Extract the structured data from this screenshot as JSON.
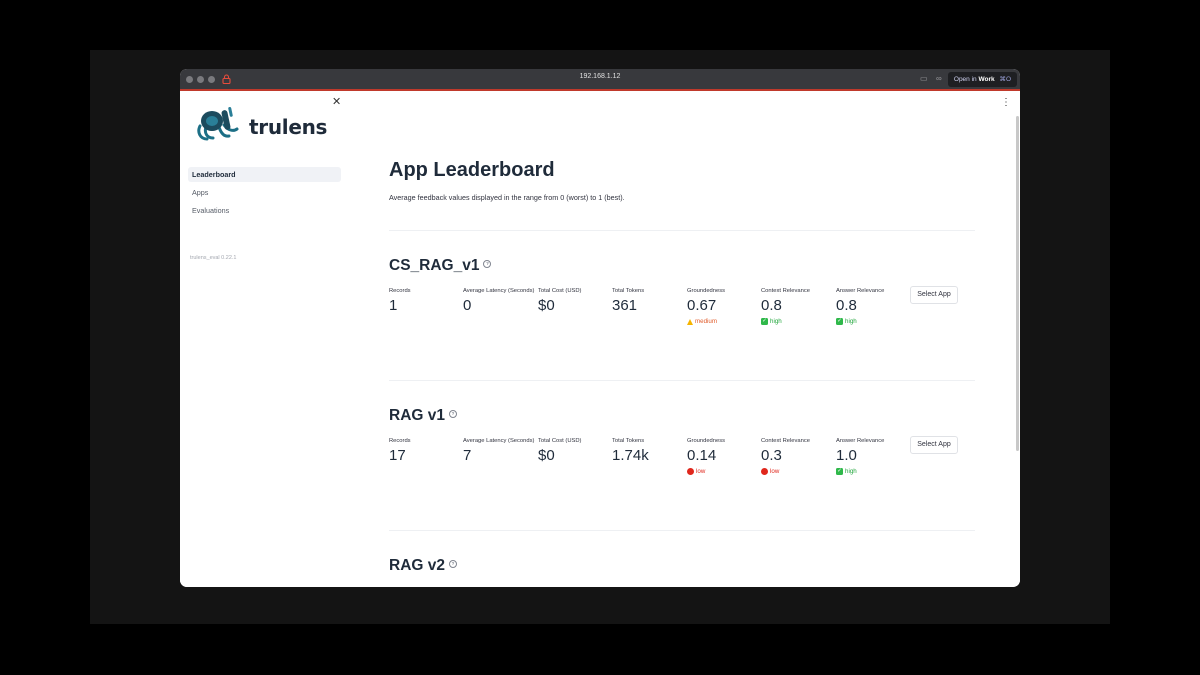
{
  "browser": {
    "url": "192.168.1.12",
    "open_in_prefix": "Open in",
    "open_in_target": "Work",
    "open_in_shortcut": "⌘O"
  },
  "sidebar": {
    "brand": "trulens",
    "nav": [
      {
        "label": "Leaderboard",
        "active": true
      },
      {
        "label": "Apps",
        "active": false
      },
      {
        "label": "Evaluations",
        "active": false
      }
    ],
    "version": "trulens_eval 0.22.1"
  },
  "main": {
    "title": "App Leaderboard",
    "subtitle": "Average feedback values displayed in the range from 0 (worst) to 1 (best).",
    "metric_labels": [
      "Records",
      "Average Latency (Seconds)",
      "Total Cost (USD)",
      "Total Tokens",
      "Groundedness",
      "Context Relevance",
      "Answer Relevance"
    ],
    "select_label": "Select App",
    "apps": [
      {
        "name": "CS_RAG_v1",
        "records": "1",
        "latency": "0",
        "cost": "$0",
        "tokens": "361",
        "groundedness": "0.67",
        "groundedness_delta": "medium",
        "context_relevance": "0.8",
        "context_relevance_delta": "high",
        "answer_relevance": "0.8",
        "answer_relevance_delta": "high"
      },
      {
        "name": "RAG v1",
        "records": "17",
        "latency": "7",
        "cost": "$0",
        "tokens": "1.74k",
        "groundedness": "0.14",
        "groundedness_delta": "low",
        "context_relevance": "0.3",
        "context_relevance_delta": "low",
        "answer_relevance": "1.0",
        "answer_relevance_delta": "high"
      },
      {
        "name": "RAG v2"
      }
    ]
  },
  "colors": {
    "accent_red": "#c0392b",
    "high": "#21a63c",
    "medium": "#e05b2b",
    "low": "#e0271c",
    "warning": "#f5b400"
  }
}
